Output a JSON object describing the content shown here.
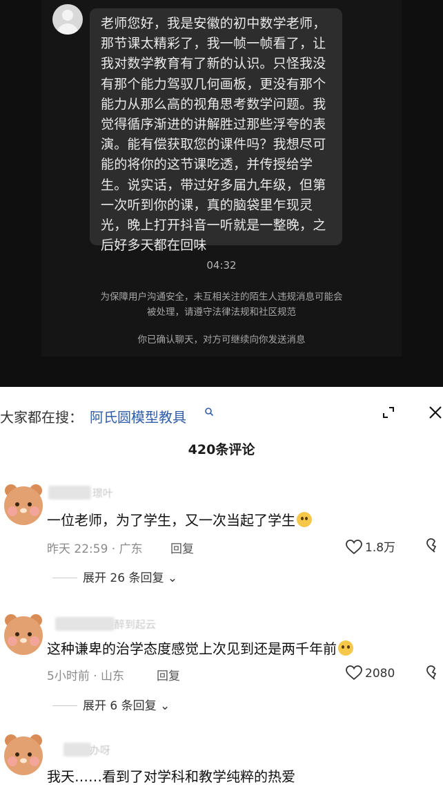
{
  "chat": {
    "message_lines": [
      "老师您好，我是安徽的初中数学老师，",
      "那节课太精彩了，我一帧一帧看了，让",
      "我对数学教育有了新的认识。只怪我没",
      "有那个能力驾驭几何画板，更没有那个",
      "能力从那么高的视角思考数学问题。我",
      "觉得循序渐进的讲解胜过那些浮夸的表",
      "演。能有偿获取您的课件吗？我想尽可",
      "能的将你的这节课吃透，并传授给学",
      "生。说实话，带过好多届九年级，但第",
      "一次听到你的课，真的脑袋里乍现灵",
      "光，晚上打开抖音一听就是一整晚，之",
      "后好多天都在回味"
    ],
    "time": "04:32",
    "notice_line1": "为保障用户沟通安全，未互相关注的陌生人违规消息可能会",
    "notice_line2": "被处理，请遵守法律法规和社区规范",
    "confirm": "你已确认聊天，对方可继续向你发送消息"
  },
  "search": {
    "label": "大家都在搜：",
    "query": "阿氏圆模型教具",
    "icon": "search-icon"
  },
  "comments_count": "420条评论",
  "comments": [
    {
      "name_tail": "     璟叶",
      "text": "一位老师，为了学生，又一次当起了学生",
      "emoji": "thinking-face",
      "time_loc": "昨天 22:59 · 广东",
      "reply": "回复",
      "likes": "1.8万",
      "expand": "展开 26 条回复"
    },
    {
      "name_tail": "     醉到起云",
      "text": "这种谦卑的治学态度感觉上次见到还是两千年前",
      "emoji": "pleading-face",
      "time_loc": "5小时前 · 山东",
      "reply": "回复",
      "likes": "2080",
      "expand": "展开 6 条回复"
    },
    {
      "name_tail": "     办呀",
      "text": "我天……看到了对学科和教学纯粹的热爱"
    }
  ],
  "colors": {
    "chat_bg": "#0f0f0f",
    "bubble_bg": "#2d2d2d",
    "search_link": "#2f5ca8",
    "avatar_bear": "#e3a070"
  }
}
